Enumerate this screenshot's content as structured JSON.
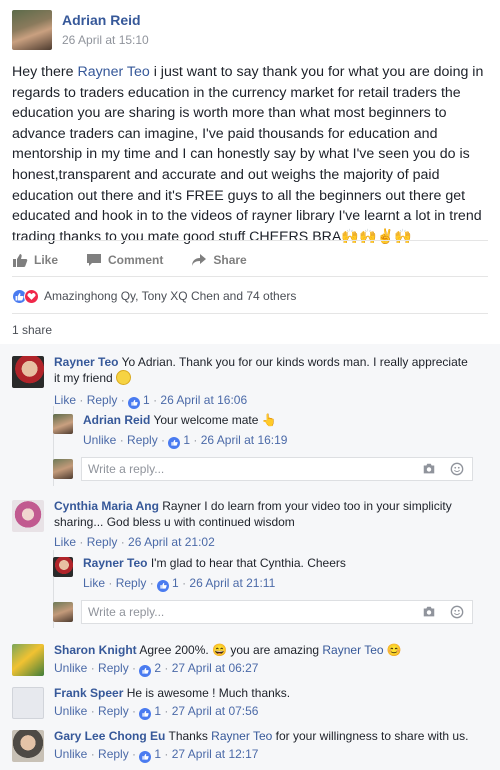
{
  "post": {
    "author": "Adrian Reid",
    "timestamp": "26 April at 15:10",
    "text_pre": "Hey there ",
    "mention": "Rayner Teo",
    "text_post": " i just want to say thank you for what you are doing in regards to traders education in the currency market for retail traders the education you are sharing is worth more than what most beginners to advance traders can imagine, I've paid thousands for education and mentorship in my time and I can honestly say by what I've seen you do is honest,transparent and accurate and out weighs the majority of paid education out there and it's FREE guys to all the beginners out there get educated and hook in to the videos of rayner library I've learnt a lot in trend trading thanks to you mate good stuff CHEERS BRA",
    "text_emoji": "🙌🙌✌🙌"
  },
  "actions": {
    "like": "Like",
    "comment": "Comment",
    "share": "Share"
  },
  "reactions": {
    "text": "Amazinghong Qy, Tony XQ Chen and 74 others"
  },
  "shares": "1 share",
  "reply_placeholder": "Write a reply...",
  "comments": [
    {
      "author": "Rayner Teo",
      "text": "Yo Adrian. Thank you for our kinds words man. I really appreciate it my friend",
      "meta_like": "Like",
      "meta_reply": "Reply",
      "likes": "1",
      "time": "26 April at 16:06",
      "replies": [
        {
          "author": "Adrian Reid",
          "text": "Your welcome mate 👆",
          "meta_like": "Unlike",
          "meta_reply": "Reply",
          "likes": "1",
          "time": "26 April at 16:19"
        }
      ]
    },
    {
      "author": "Cynthia Maria Ang",
      "text": "Rayner I do learn from your video too in your simplicity sharing... God bless u with continued wisdom",
      "meta_like": "Like",
      "meta_reply": "Reply",
      "time": "26 April at 21:02",
      "replies": [
        {
          "author": "Rayner Teo",
          "text": "I'm glad to hear that Cynthia. Cheers",
          "meta_like": "Like",
          "meta_reply": "Reply",
          "likes": "1",
          "time": "26 April at 21:11"
        }
      ]
    },
    {
      "author": "Sharon Knight",
      "text_pre": "Agree 200%. 😄 you are amazing ",
      "mention": "Rayner Teo",
      "text_post": " 😊",
      "meta_like": "Unlike",
      "meta_reply": "Reply",
      "likes": "2",
      "time": "27 April at 06:27"
    },
    {
      "author": "Frank Speer",
      "text": "He is awesome ! Much thanks.",
      "meta_like": "Unlike",
      "meta_reply": "Reply",
      "likes": "1",
      "time": "27 April at 07:56"
    },
    {
      "author": "Gary Lee Chong Eu",
      "text_pre": "Thanks ",
      "mention": "Rayner Teo",
      "text_post": " for your willingness to share with us.",
      "meta_like": "Unlike",
      "meta_reply": "Reply",
      "likes": "1",
      "time": "27 April at 12:17"
    }
  ]
}
